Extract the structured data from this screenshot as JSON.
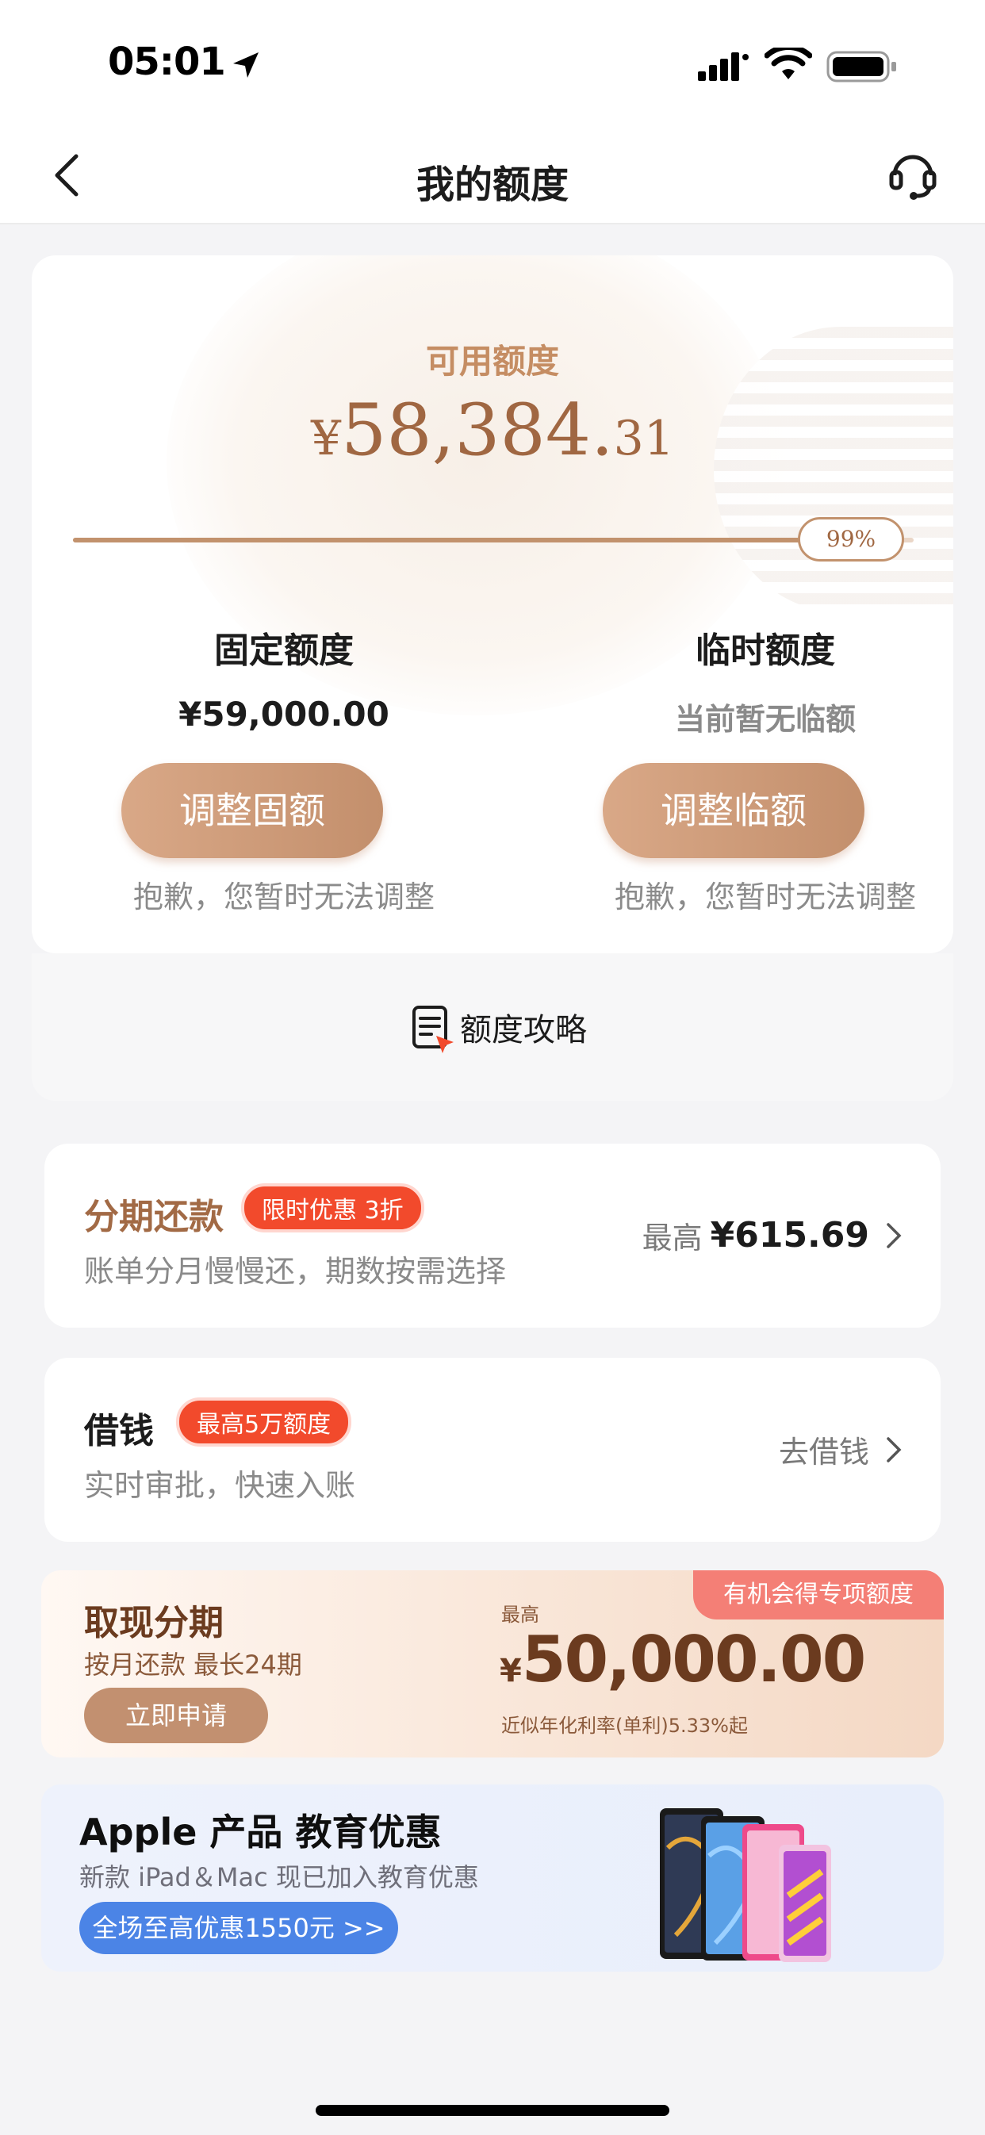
{
  "status_bar": {
    "time": "05:01"
  },
  "nav": {
    "title": "我的额度"
  },
  "quota": {
    "available_label": "可用额度",
    "currency_symbol": "¥",
    "available_main": "58,384.",
    "available_decimal": "31",
    "progress_percent": 99,
    "progress_label": "99%",
    "fixed": {
      "title": "固定额度",
      "value": "¥59,000.00",
      "button": "调整固额",
      "note": "抱歉，您暂时无法调整"
    },
    "temporary": {
      "title": "临时额度",
      "value": "当前暂无临额",
      "button": "调整临额",
      "note": "抱歉，您暂时无法调整"
    }
  },
  "strategy": {
    "label": "额度攻略"
  },
  "installment": {
    "title": "分期还款",
    "tag": "限时优惠 3折",
    "subtitle": "账单分月慢慢还，期数按需选择",
    "max_label": "最高",
    "max_value": "¥615.69"
  },
  "borrow": {
    "title": "借钱",
    "tag": "最高5万额度",
    "subtitle": "实时审批，快速入账",
    "action": "去借钱"
  },
  "cash_installment": {
    "title": "取现分期",
    "subtitle": "按月还款 最长24期",
    "button": "立即申请",
    "max_label": "最高",
    "currency_symbol": "¥",
    "amount": "50,000.00",
    "rate": "近似年化利率(单利)5.33%起",
    "chance": "有机会得专项额度"
  },
  "apple_banner": {
    "title": "Apple 产品 教育优惠",
    "subtitle": "新款 iPad＆Mac 现已加入教育优惠",
    "button": "全场至高优惠1550元 >>"
  },
  "colors": {
    "accent": "#c2926d",
    "promo_red": "#f24a2c",
    "blue": "#4b84e6"
  }
}
